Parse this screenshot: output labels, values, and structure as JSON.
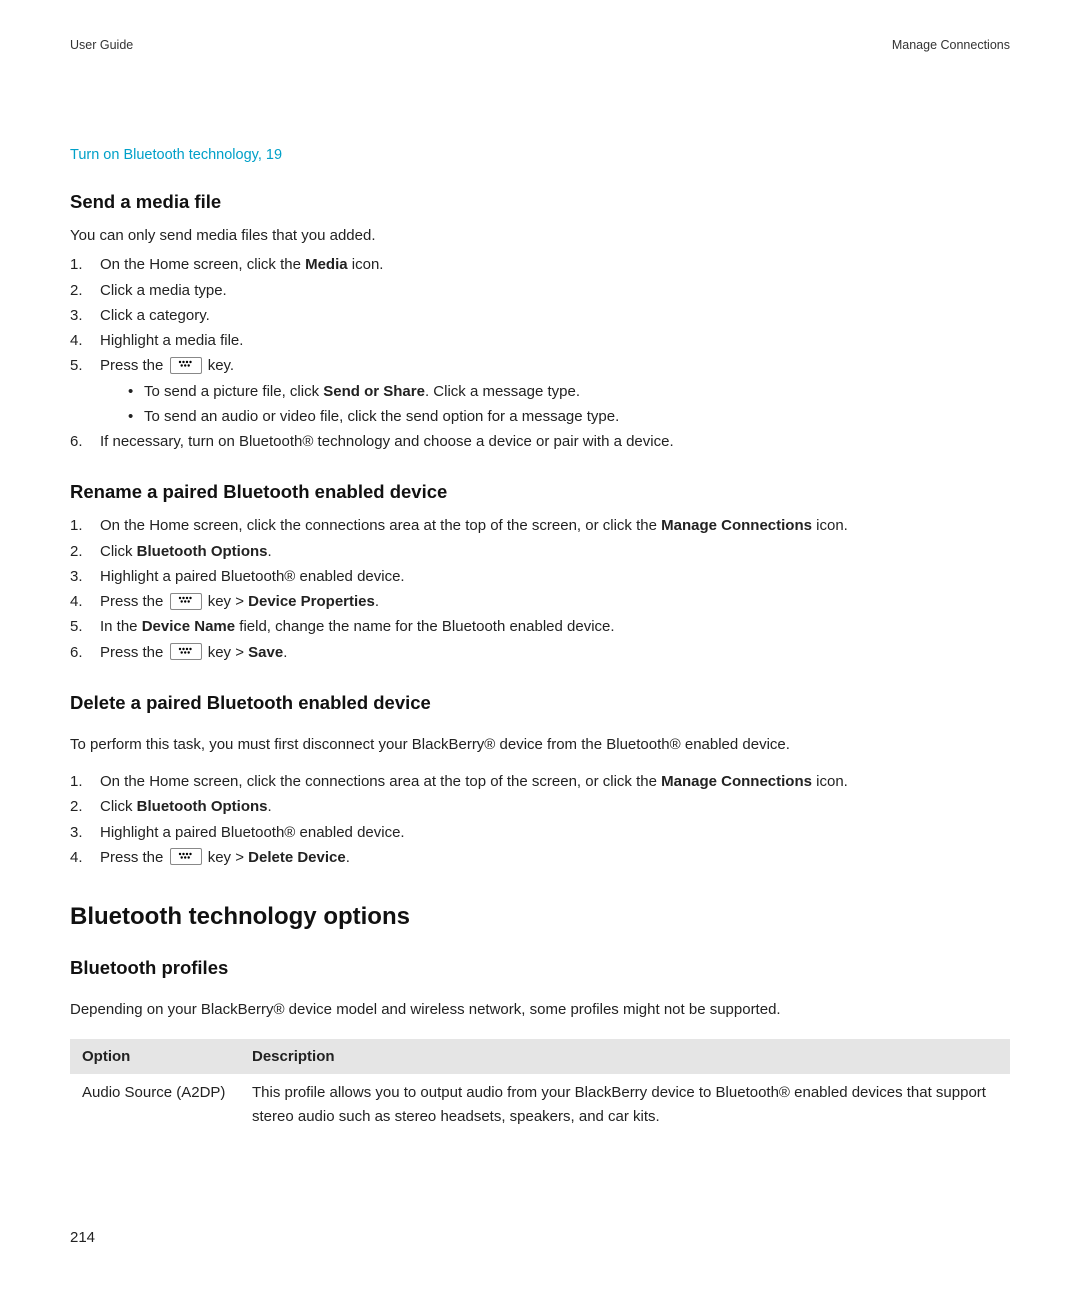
{
  "header": {
    "left": "User Guide",
    "right": "Manage Connections"
  },
  "topLink": "Turn on Bluetooth technology, 19",
  "section1": {
    "title": "Send a media file",
    "intro": "You can only send media files that you added.",
    "steps": {
      "s1a": "On the Home screen, click the ",
      "s1b": "Media",
      "s1c": " icon.",
      "s2": "Click a media type.",
      "s3": "Click a category.",
      "s4": "Highlight a media file.",
      "s5a": "Press the ",
      "s5b": " key.",
      "s5sub1a": "To send a picture file, click ",
      "s5sub1b": "Send or Share",
      "s5sub1c": ". Click a message type.",
      "s5sub2": "To send an audio or video file, click the send option for a message type.",
      "s6": "If necessary, turn on Bluetooth® technology and choose a device or pair with a device."
    }
  },
  "section2": {
    "title": "Rename a paired Bluetooth enabled device",
    "steps": {
      "s1a": "On the Home screen, click the connections area at the top of the screen, or click the ",
      "s1b": "Manage Connections",
      "s1c": " icon.",
      "s2a": "Click ",
      "s2b": "Bluetooth Options",
      "s2c": ".",
      "s3": "Highlight a paired Bluetooth® enabled device.",
      "s4a": "Press the ",
      "s4b": " key > ",
      "s4c": "Device Properties",
      "s4d": ".",
      "s5a": "In the ",
      "s5b": "Device Name",
      "s5c": " field, change the name for the Bluetooth enabled device.",
      "s6a": "Press the ",
      "s6b": " key > ",
      "s6c": "Save",
      "s6d": "."
    }
  },
  "section3": {
    "title": "Delete a paired Bluetooth enabled device",
    "intro": "To perform this task, you must first disconnect your BlackBerry® device from the Bluetooth® enabled device.",
    "steps": {
      "s1a": "On the Home screen, click the connections area at the top of the screen, or click the ",
      "s1b": "Manage Connections",
      "s1c": " icon.",
      "s2a": "Click ",
      "s2b": "Bluetooth Options",
      "s2c": ".",
      "s3": "Highlight a paired Bluetooth® enabled device.",
      "s4a": "Press the ",
      "s4b": " key > ",
      "s4c": "Delete Device",
      "s4d": "."
    }
  },
  "section4": {
    "title": "Bluetooth technology options",
    "subTitle": "Bluetooth profiles",
    "intro": "Depending on your BlackBerry® device model and wireless network, some profiles might not be supported.",
    "tableHeaders": {
      "c1": "Option",
      "c2": "Description"
    },
    "row1": {
      "c1": "Audio Source (A2DP)",
      "c2": "This profile allows you to output audio from your BlackBerry device to Bluetooth® enabled devices that support stereo audio such as stereo headsets, speakers, and car kits."
    }
  },
  "pageNum": "214"
}
